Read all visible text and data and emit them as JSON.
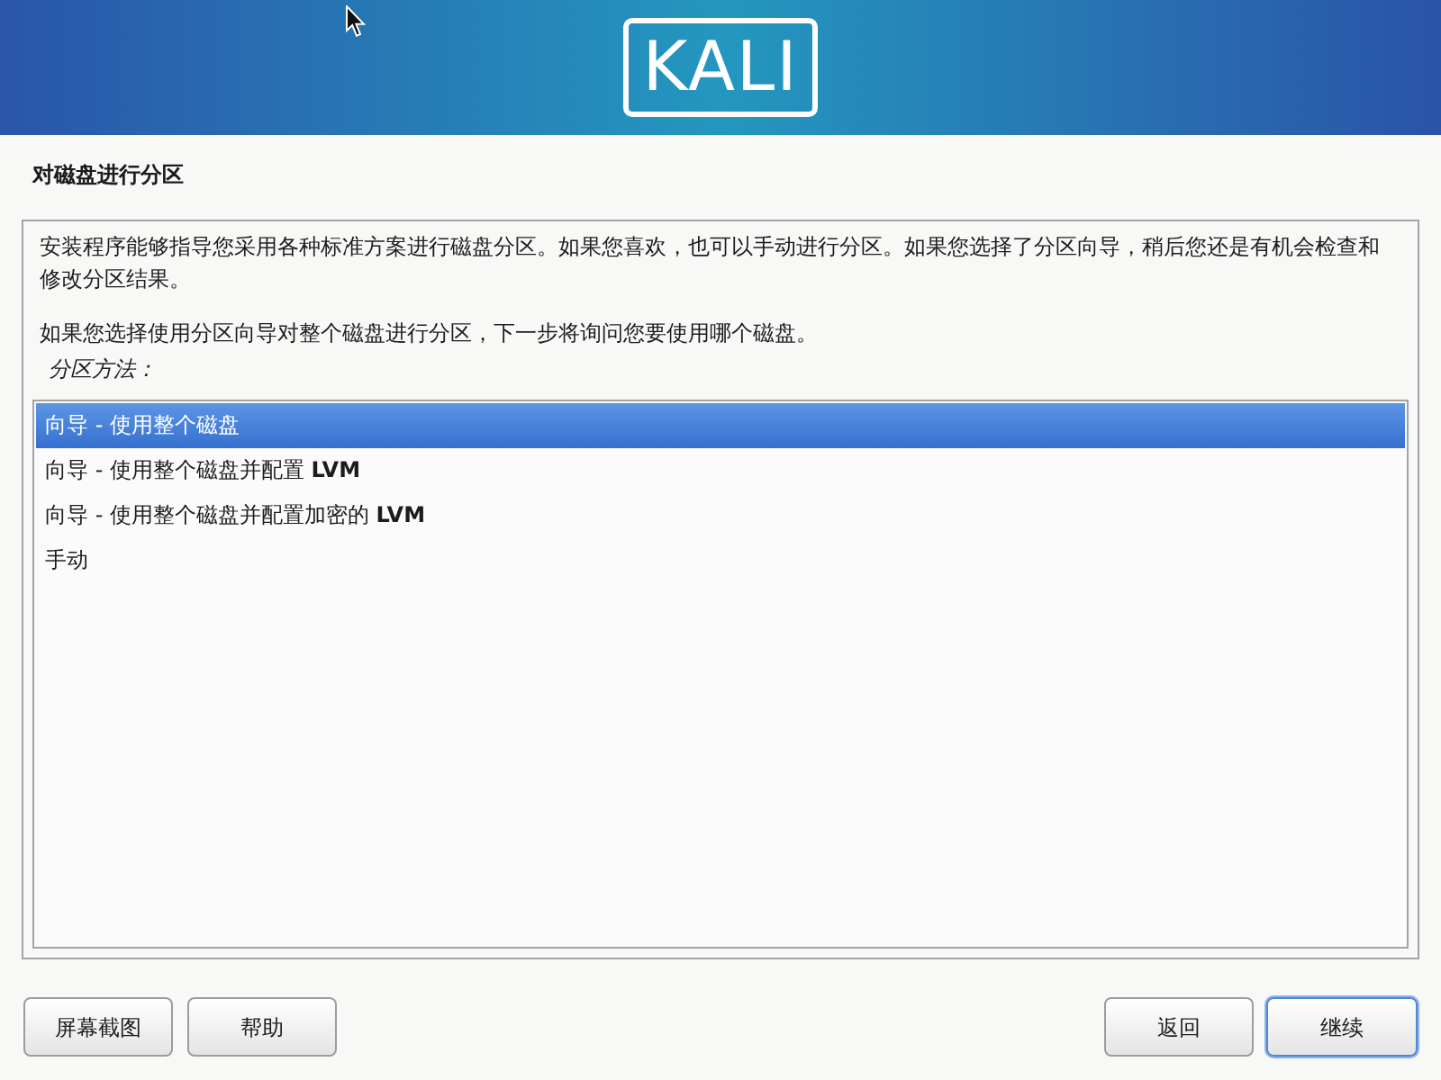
{
  "header": {
    "logo_text": "KALI"
  },
  "title": "对磁盘进行分区",
  "description": [
    "安装程序能够指导您采用各种标准方案进行磁盘分区。如果您喜欢，也可以手动进行分区。如果您选择了分区向导，稍后您还是有机会检查和修改分区结果。",
    "如果您选择使用分区向导对整个磁盘进行分区，下一步将询问您要使用哪个磁盘。"
  ],
  "method_label": "分区方法：",
  "options": [
    {
      "label": "向导 - 使用整个磁盘",
      "selected": true
    },
    {
      "label": "向导 - 使用整个磁盘并配置 **LVM**",
      "selected": false
    },
    {
      "label": "向导 - 使用整个磁盘并配置加密的 **LVM**",
      "selected": false
    },
    {
      "label": "手动",
      "selected": false
    }
  ],
  "left_buttons": [
    {
      "label": "屏幕截图",
      "focused": false
    },
    {
      "label": "帮助",
      "focused": false
    }
  ],
  "right_buttons": [
    {
      "label": "返回",
      "focused": false
    },
    {
      "label": "继续",
      "focused": true
    }
  ]
}
